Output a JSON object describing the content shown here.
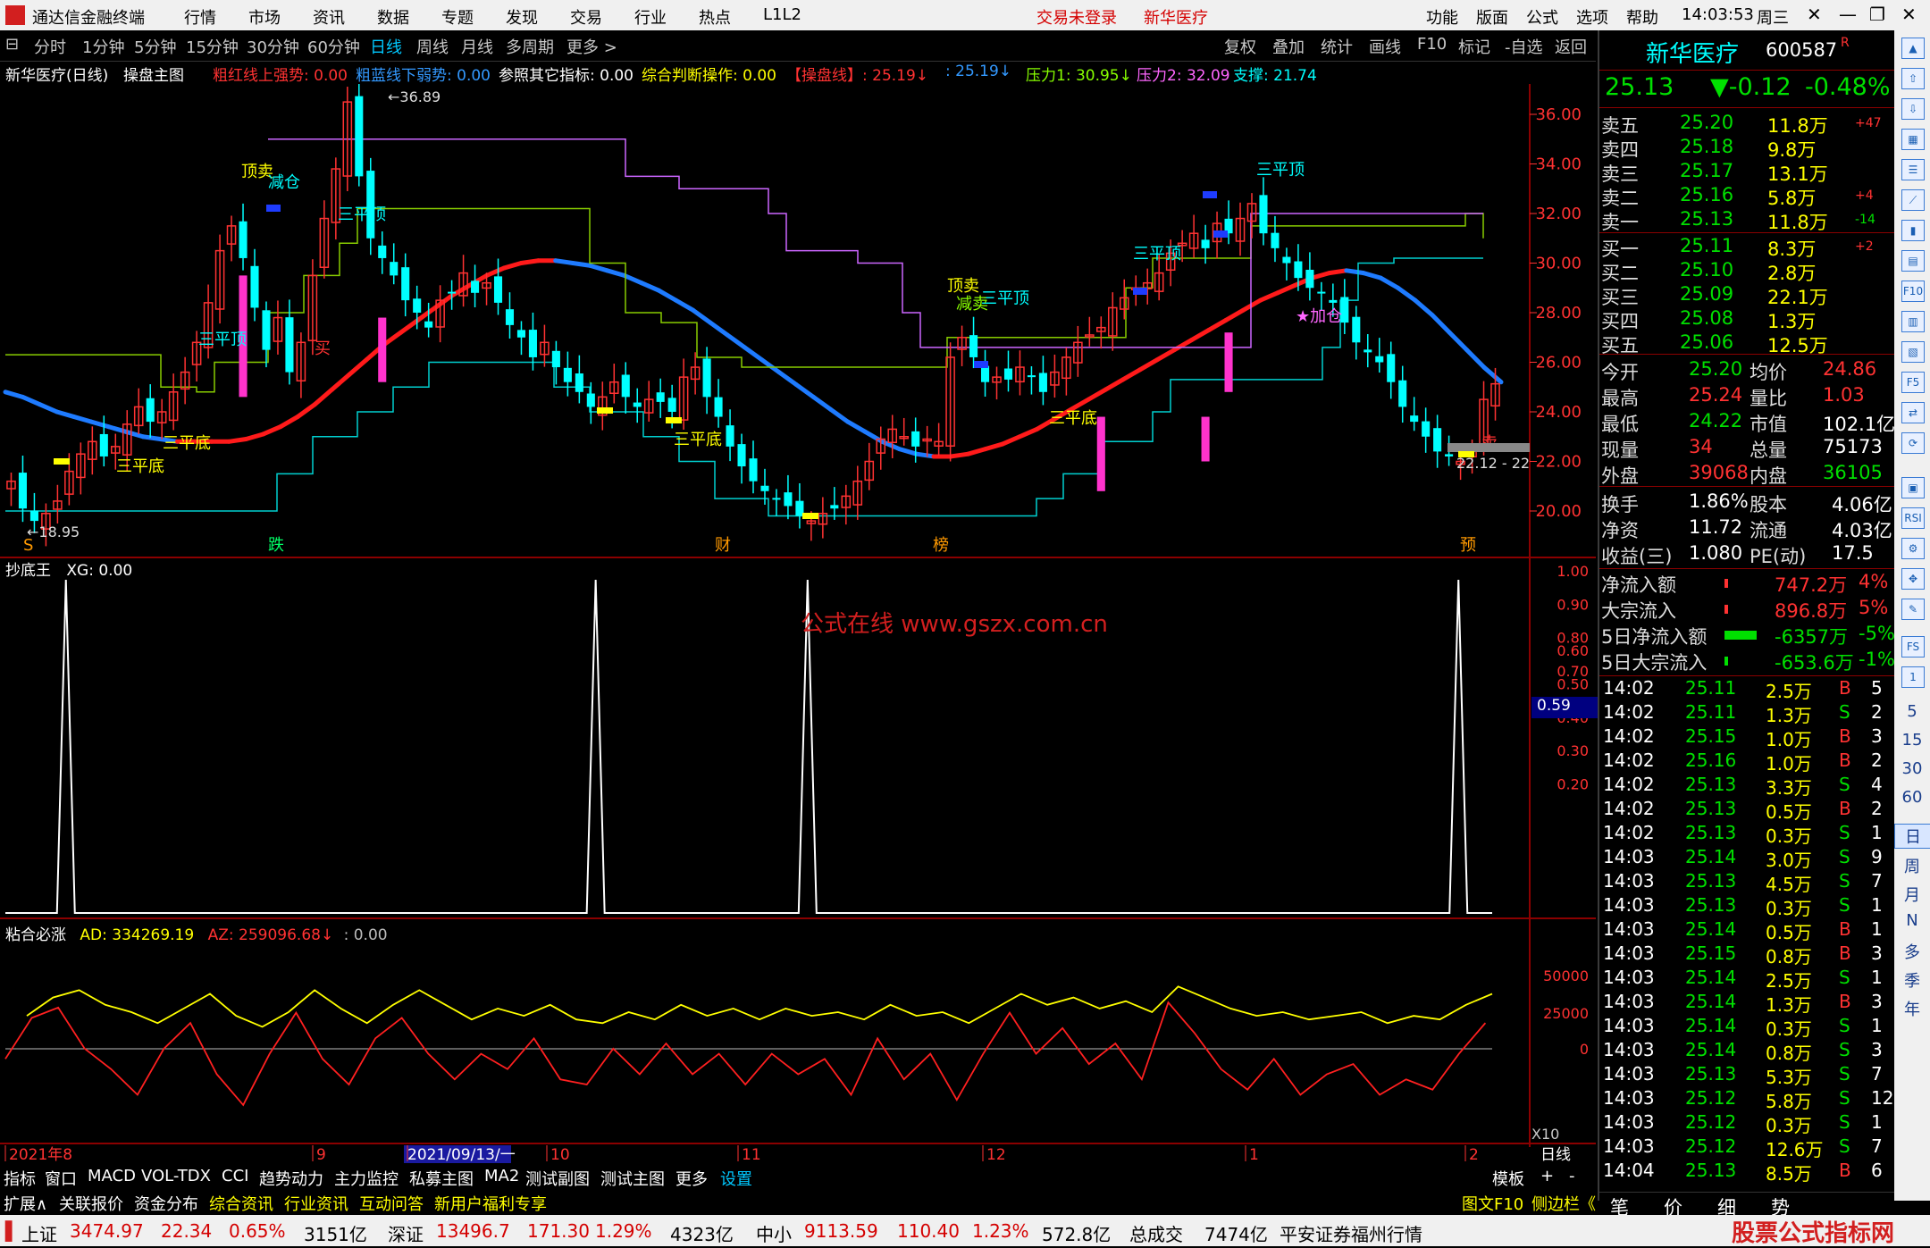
{
  "titlebar": {
    "app_name": "通达信金融终端",
    "menus": [
      "行情",
      "市场",
      "资讯",
      "数据",
      "专题",
      "发现",
      "交易",
      "行业",
      "热点",
      "L1L2"
    ],
    "login_status": "交易未登录",
    "stock_name": "新华医疗",
    "right_menus": [
      "功能",
      "版面",
      "公式",
      "选项",
      "帮助"
    ],
    "time": "14:03:53",
    "weekday": "周三"
  },
  "periodbar": {
    "items": [
      "分时",
      "1分钟",
      "5分钟",
      "15分钟",
      "30分钟",
      "60分钟",
      "日线",
      "周线",
      "月线",
      "多周期",
      "更多 >"
    ],
    "active": "日线",
    "right_items": [
      "复权",
      "叠加",
      "统计",
      "画线",
      "F10",
      "标记",
      "-自选",
      "返回"
    ]
  },
  "infobar": {
    "stock": "新华医疗(日线)",
    "formula": "操盘主图",
    "items": [
      {
        "text": "粗红线上强势: 0.00",
        "color": "#ff3232"
      },
      {
        "text": "粗蓝线下弱势: 0.00",
        "color": "#3399ff"
      },
      {
        "text": "参照其它指标: 0.00",
        "color": "#ffffff"
      },
      {
        "text": "综合判断操作: 0.00",
        "color": "#ffff00"
      },
      {
        "text": "【操盘线】: 25.19↓",
        "color": "#ff3232"
      },
      {
        "text": ": 25.19↓",
        "color": "#3399ff"
      },
      {
        "text": "压力1: 30.95↓",
        "color": "#88ff00"
      },
      {
        "text": "压力2: 32.09",
        "color": "#ff66ff"
      },
      {
        "text": "支撑: 21.74",
        "color": "#00ffff"
      }
    ]
  },
  "main_chart": {
    "y_ticks": [
      "36.00",
      "34.00",
      "32.00",
      "30.00",
      "28.00",
      "26.00",
      "24.00",
      "22.00",
      "20.00"
    ],
    "high_label": "36.89",
    "low_label": "18.95",
    "last_range": "22.12 - 22",
    "signals": [
      "顶卖",
      "减仓",
      "买",
      "三平顶",
      "三平顶",
      "三平顶",
      "三平顶",
      "三平顶",
      "三平底",
      "三平底",
      "三平底",
      "三平底",
      "顶卖",
      "减卖",
      "卖",
      "加仓"
    ],
    "bottom_marks": [
      "S",
      "跌",
      "财",
      "榜",
      "预"
    ]
  },
  "sub1": {
    "title": "抄底王",
    "value": "XG: 0.00",
    "y_ticks": [
      "1.00",
      "0.90",
      "0.80",
      "0.70",
      "0.60",
      "0.50",
      "0.40",
      "0.30",
      "0.20"
    ],
    "cursor_value": "0.59",
    "watermark": "公式在线  www.gszx.com.cn"
  },
  "sub2": {
    "title": "粘合必涨",
    "ad": "AD: 334269.19",
    "az": "AZ: 259096.68↓",
    "zero": ": 0.00",
    "y_ticks": [
      "50000",
      "25000",
      "0"
    ],
    "scale": "X10"
  },
  "time_axis": {
    "labels": [
      "2021年8",
      "9",
      "2021/09/13/一",
      "10",
      "11",
      "12",
      "1",
      "2"
    ],
    "period": "日线"
  },
  "quote": {
    "name": "新华医疗",
    "code": "600587",
    "badge": "R",
    "price": "25.13",
    "change": "▼-0.12",
    "pct": "-0.48%",
    "asks": [
      {
        "label": "卖五",
        "price": "25.20",
        "vol": "11.8万",
        "delta": "+47"
      },
      {
        "label": "卖四",
        "price": "25.18",
        "vol": "9.8万",
        "delta": ""
      },
      {
        "label": "卖三",
        "price": "25.17",
        "vol": "13.1万",
        "delta": ""
      },
      {
        "label": "卖二",
        "price": "25.16",
        "vol": "5.8万",
        "delta": "+4"
      },
      {
        "label": "卖一",
        "price": "25.13",
        "vol": "11.8万",
        "delta": "-14"
      }
    ],
    "bids": [
      {
        "label": "买一",
        "price": "25.11",
        "vol": "8.3万",
        "delta": "+2"
      },
      {
        "label": "买二",
        "price": "25.10",
        "vol": "2.8万",
        "delta": ""
      },
      {
        "label": "买三",
        "price": "25.09",
        "vol": "22.1万",
        "delta": ""
      },
      {
        "label": "买四",
        "price": "25.08",
        "vol": "1.3万",
        "delta": ""
      },
      {
        "label": "买五",
        "price": "25.06",
        "vol": "12.5万",
        "delta": ""
      }
    ],
    "stats": [
      {
        "l1": "今开",
        "v1": "25.20",
        "l2": "均价",
        "v2": "24.86"
      },
      {
        "l1": "最高",
        "v1": "25.24",
        "l2": "量比",
        "v2": "1.03"
      },
      {
        "l1": "最低",
        "v1": "24.22",
        "l2": "市值",
        "v2": "102.1亿"
      },
      {
        "l1": "现量",
        "v1": "34",
        "l2": "总量",
        "v2": "75173"
      },
      {
        "l1": "外盘",
        "v1": "39068",
        "l2": "内盘",
        "v2": "36105"
      }
    ],
    "stats2": [
      {
        "l1": "换手",
        "v1": "1.86%",
        "l2": "股本",
        "v2": "4.06亿"
      },
      {
        "l1": "净资",
        "v1": "11.72",
        "l2": "流通",
        "v2": "4.03亿"
      },
      {
        "l1": "收益(三)",
        "v1": "1.080",
        "l2": "PE(动)",
        "v2": "17.5"
      }
    ],
    "flows": [
      {
        "label": "净流入额",
        "value": "747.2万",
        "pct": "4%",
        "dir": "up"
      },
      {
        "label": "大宗流入",
        "value": "896.8万",
        "pct": "5%",
        "dir": "up"
      },
      {
        "label": "5日净流入额",
        "value": "-6357万",
        "pct": "-5%",
        "dir": "dn"
      },
      {
        "label": "5日大宗流入",
        "value": "-653.6万",
        "pct": "-1%",
        "dir": "dn"
      }
    ],
    "ticks": [
      {
        "t": "14:02",
        "p": "25.11",
        "v": "2.5万",
        "s": "B",
        "n": "5"
      },
      {
        "t": "14:02",
        "p": "25.11",
        "v": "1.3万",
        "s": "S",
        "n": "2"
      },
      {
        "t": "14:02",
        "p": "25.15",
        "v": "1.0万",
        "s": "B",
        "n": "3"
      },
      {
        "t": "14:02",
        "p": "25.16",
        "v": "1.0万",
        "s": "B",
        "n": "2"
      },
      {
        "t": "14:02",
        "p": "25.13",
        "v": "3.3万",
        "s": "S",
        "n": "4"
      },
      {
        "t": "14:02",
        "p": "25.13",
        "v": "0.5万",
        "s": "B",
        "n": "2"
      },
      {
        "t": "14:02",
        "p": "25.13",
        "v": "0.3万",
        "s": "S",
        "n": "1"
      },
      {
        "t": "14:03",
        "p": "25.14",
        "v": "3.0万",
        "s": "S",
        "n": "9"
      },
      {
        "t": "14:03",
        "p": "25.13",
        "v": "4.5万",
        "s": "S",
        "n": "7"
      },
      {
        "t": "14:03",
        "p": "25.13",
        "v": "0.3万",
        "s": "S",
        "n": "1"
      },
      {
        "t": "14:03",
        "p": "25.14",
        "v": "0.5万",
        "s": "B",
        "n": "1"
      },
      {
        "t": "14:03",
        "p": "25.15",
        "v": "0.8万",
        "s": "B",
        "n": "3"
      },
      {
        "t": "14:03",
        "p": "25.14",
        "v": "2.5万",
        "s": "S",
        "n": "1"
      },
      {
        "t": "14:03",
        "p": "25.14",
        "v": "1.3万",
        "s": "B",
        "n": "3"
      },
      {
        "t": "14:03",
        "p": "25.14",
        "v": "0.3万",
        "s": "S",
        "n": "1"
      },
      {
        "t": "14:03",
        "p": "25.14",
        "v": "0.8万",
        "s": "S",
        "n": "3"
      },
      {
        "t": "14:03",
        "p": "25.13",
        "v": "5.3万",
        "s": "S",
        "n": "7"
      },
      {
        "t": "14:03",
        "p": "25.12",
        "v": "5.8万",
        "s": "S",
        "n": "12"
      },
      {
        "t": "14:03",
        "p": "25.12",
        "v": "0.3万",
        "s": "S",
        "n": "1"
      },
      {
        "t": "14:03",
        "p": "25.12",
        "v": "12.6万",
        "s": "S",
        "n": "7"
      },
      {
        "t": "14:04",
        "p": "25.13",
        "v": "8.5万",
        "s": "B",
        "n": "6"
      }
    ],
    "bottom_tabs": [
      "笔",
      "价",
      "细",
      "势"
    ]
  },
  "sidebar": {
    "vertical": [
      "日",
      "周",
      "月",
      "N",
      "多",
      "季",
      "年"
    ],
    "nums": [
      "5",
      "15",
      "30",
      "60"
    ]
  },
  "bottom_tabs": {
    "row1": [
      "指标",
      "窗口",
      "MACD",
      "VOL-TDX",
      "CCI",
      "趋势动力",
      "主力监控",
      "私募主图",
      "MA2",
      "测试副图",
      "测试主图",
      "更多",
      "设置"
    ],
    "row1_right": [
      "模板",
      "+",
      "-"
    ],
    "row2": [
      "扩展∧",
      "关联报价",
      "资金分布",
      "综合资讯",
      "行业资讯",
      "互动问答",
      "新用户福利专享"
    ],
    "row2_right": [
      "图文F10",
      "侧边栏《"
    ]
  },
  "statusbar": {
    "items": [
      {
        "name": "上证",
        "v": "3474.97",
        "c": "22.34",
        "p": "0.65%",
        "a": "3151亿"
      },
      {
        "name": "深证",
        "v": "13496.7",
        "c": "171.30",
        "p": "1.29%",
        "a": "4323亿"
      },
      {
        "name": "中小",
        "v": "9113.59",
        "c": "110.40",
        "p": "1.23%",
        "a": "572.8亿"
      }
    ],
    "total_label": "总成交",
    "total": "7474亿",
    "broker": "平安证券福州行情",
    "brand": "股票公式指标网",
    "brand_url": "www.gszx.com"
  },
  "chart_data": {
    "type": "candlestick",
    "price_range": [
      18.5,
      37.5
    ],
    "closes": [
      21.2,
      20.1,
      19.6,
      19.9,
      20.4,
      21.6,
      22.3,
      22.8,
      22.2,
      22.6,
      23.5,
      24.2,
      23.6,
      24.0,
      24.8,
      25.6,
      26.8,
      28.4,
      30.5,
      31.5,
      30.2,
      28.2,
      26.5,
      27.8,
      25.6,
      26.8,
      29.5,
      31.8,
      33.8,
      36.5,
      33.5,
      31.0,
      30.2,
      29.5,
      28.5,
      28.0,
      27.4,
      28.5,
      28.8,
      29.6,
      28.8,
      29.2,
      28.4,
      27.5,
      27.0,
      26.2,
      26.8,
      25.8,
      25.2,
      24.8,
      24.2,
      24.6,
      25.2,
      24.6,
      24.2,
      24.5,
      24.4,
      24.0,
      25.4,
      25.8,
      24.6,
      23.8,
      22.6,
      21.8,
      21.2,
      20.8,
      20.5,
      20.2,
      19.8,
      19.6,
      19.9,
      20.1,
      20.6,
      21.2,
      22.0,
      22.9,
      23.3,
      23.0,
      22.6,
      22.9,
      22.8,
      26.2,
      27.0,
      26.2,
      25.2,
      25.4,
      25.3,
      25.8,
      25.4,
      24.8,
      25.6,
      26.2,
      26.8,
      27.1,
      27.4,
      28.2,
      28.6,
      29.0,
      29.2,
      29.6,
      30.4,
      30.8,
      31.2,
      30.6,
      31.6,
      31.2,
      31.8,
      32.4,
      31.2,
      30.6,
      30.0,
      29.4,
      29.0,
      28.8,
      28.4,
      27.6,
      26.8,
      26.4,
      26.0,
      25.2,
      24.2,
      23.6,
      23.0,
      22.4,
      22.2,
      22.0,
      22.4,
      24.5,
      25.13
    ],
    "ma_trend": [
      24.8,
      24.6,
      24.3,
      24.0,
      23.8,
      23.6,
      23.4,
      23.2,
      23.0,
      22.9,
      22.8,
      22.8,
      22.8,
      22.8,
      22.9,
      23.1,
      23.4,
      23.8,
      24.3,
      24.9,
      25.5,
      26.1,
      26.7,
      27.2,
      27.7,
      28.2,
      28.7,
      29.1,
      29.5,
      29.8,
      30.0,
      30.1,
      30.1,
      30.0,
      29.9,
      29.7,
      29.5,
      29.2,
      28.9,
      28.5,
      28.1,
      27.6,
      27.1,
      26.6,
      26.1,
      25.6,
      25.1,
      24.6,
      24.1,
      23.6,
      23.2,
      22.8,
      22.5,
      22.3,
      22.2,
      22.2,
      22.3,
      22.5,
      22.7,
      23.0,
      23.3,
      23.7,
      24.1,
      24.5,
      24.9,
      25.3,
      25.7,
      26.1,
      26.5,
      26.9,
      27.3,
      27.7,
      28.1,
      28.5,
      28.8,
      29.1,
      29.4,
      29.6,
      29.7,
      29.6,
      29.4,
      29.0,
      28.5,
      27.9,
      27.2,
      26.5,
      25.8,
      25.2
    ],
    "xg_spikes_at": [
      0.04,
      0.39,
      0.53,
      0.96
    ],
    "ad": [
      0.45,
      0.7,
      0.8,
      0.6,
      0.5,
      0.35,
      0.55,
      0.75,
      0.45,
      0.3,
      0.5,
      0.8,
      0.55,
      0.35,
      0.6,
      0.8,
      0.6,
      0.4,
      0.55,
      0.45,
      0.6,
      0.4,
      0.35,
      0.5,
      0.4,
      0.6,
      0.45,
      0.55,
      0.4,
      0.55,
      0.45,
      0.5,
      0.4,
      0.6,
      0.45,
      0.5,
      0.35,
      0.55,
      0.75,
      0.6,
      0.7,
      0.55,
      0.65,
      0.5,
      0.85,
      0.7,
      0.55,
      0.45,
      0.5,
      0.4,
      0.45,
      0.5,
      0.35,
      0.45,
      0.4,
      0.6,
      0.75
    ],
    "az": [
      0.25,
      0.65,
      0.75,
      0.35,
      0.15,
      -0.1,
      0.35,
      0.6,
      0.1,
      -0.2,
      0.3,
      0.7,
      0.25,
      0.0,
      0.45,
      0.65,
      0.3,
      0.05,
      0.3,
      0.15,
      0.45,
      0.05,
      0.0,
      0.35,
      0.1,
      0.4,
      0.1,
      0.3,
      0.0,
      0.3,
      0.1,
      0.25,
      -0.1,
      0.45,
      0.05,
      0.3,
      -0.15,
      0.3,
      0.7,
      0.3,
      0.55,
      0.2,
      0.4,
      0.05,
      0.8,
      0.5,
      0.15,
      -0.05,
      0.25,
      -0.1,
      0.1,
      0.2,
      -0.1,
      0.05,
      -0.05,
      0.3,
      0.6
    ]
  }
}
